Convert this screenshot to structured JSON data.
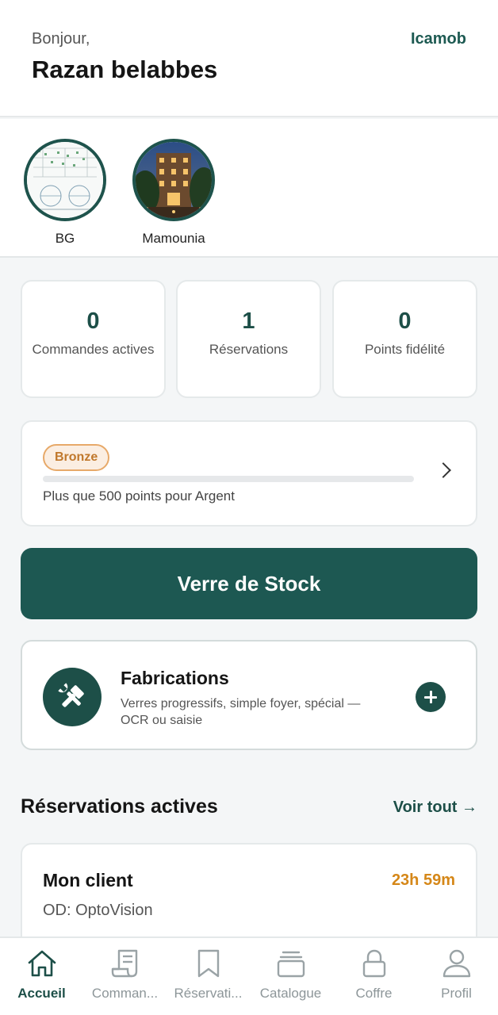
{
  "header": {
    "greeting": "Bonjour,",
    "user_name": "Razan belabbes",
    "brand_link": "Icamob"
  },
  "stories": [
    {
      "label": "BG"
    },
    {
      "label": "Mamounia"
    }
  ],
  "stats": [
    {
      "value": "0",
      "label": "Commandes actives"
    },
    {
      "value": "1",
      "label": "Réservations"
    },
    {
      "value": "0",
      "label": "Points fidélité"
    }
  ],
  "loyalty": {
    "tier": "Bronze",
    "progress_fraction": 0,
    "message": "Plus que 500 points pour Argent"
  },
  "stock_button": {
    "label": "Verre de Stock"
  },
  "fabrications": {
    "title": "Fabrications",
    "description": "Verres progressifs, simple foyer, spécial — OCR ou saisie"
  },
  "reservations_section": {
    "title": "Réservations actives",
    "see_all": "Voir tout →"
  },
  "reservation": {
    "client": "Mon client",
    "timer": "23h 59m",
    "od": "OD: OptoVision"
  },
  "colors": {
    "primary": "#1d4f48",
    "accent_orange": "#d58718",
    "bronze": "#c0782c"
  },
  "bottom_nav": [
    {
      "label": "Accueil",
      "icon": "home-icon",
      "active": true
    },
    {
      "label": "Comman...",
      "icon": "receipt-icon",
      "active": false
    },
    {
      "label": "Réservati...",
      "icon": "bookmark-icon",
      "active": false
    },
    {
      "label": "Catalogue",
      "icon": "stack-icon",
      "active": false
    },
    {
      "label": "Coffre",
      "icon": "lock-icon",
      "active": false
    },
    {
      "label": "Profil",
      "icon": "user-icon",
      "active": false
    }
  ]
}
